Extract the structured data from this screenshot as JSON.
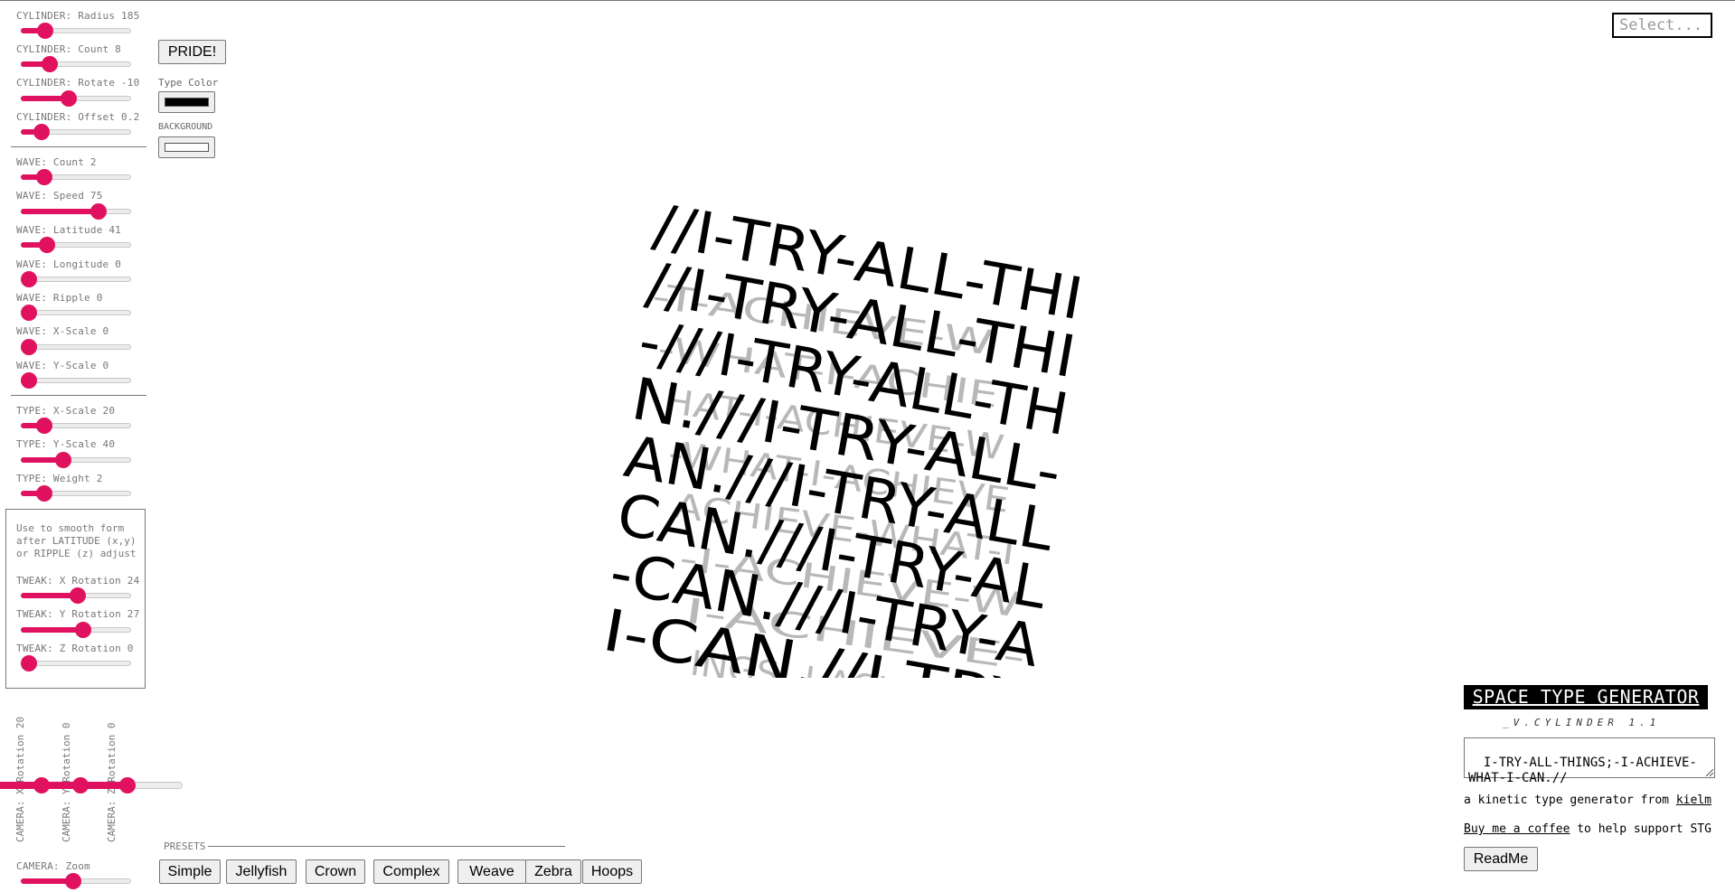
{
  "sliders": {
    "cylinder_radius": {
      "label": "CYLINDER: Radius 185",
      "value": 0.17
    },
    "cylinder_count": {
      "label": "CYLINDER: Count 8",
      "value": 0.22
    },
    "cylinder_rotate": {
      "label": "CYLINDER: Rotate -10",
      "value": 0.42
    },
    "cylinder_offset": {
      "label": "CYLINDER: Offset 0.2",
      "value": 0.13
    },
    "wave_count": {
      "label": "WAVE: Count 2",
      "value": 0.16
    },
    "wave_speed": {
      "label": "WAVE: Speed 75",
      "value": 0.74
    },
    "wave_latitude": {
      "label": "WAVE: Latitude  41",
      "value": 0.19
    },
    "wave_longitude": {
      "label": "WAVE: Longitude 0",
      "value": 0.0
    },
    "wave_ripple": {
      "label": "WAVE: Ripple 0",
      "value": 0.0
    },
    "wave_xscale": {
      "label": "WAVE: X-Scale 0",
      "value": 0.0
    },
    "wave_yscale": {
      "label": "WAVE: Y-Scale 0",
      "value": 0.0
    },
    "type_xscale": {
      "label": "TYPE: X-Scale 20",
      "value": 0.16
    },
    "type_yscale": {
      "label": "TYPE: Y-Scale 40",
      "value": 0.37
    },
    "type_weight": {
      "label": "TYPE: Weight 2",
      "value": 0.16
    },
    "tweak_x": {
      "label": "TWEAK: X Rotation 24",
      "value": 0.52
    },
    "tweak_y": {
      "label": "TWEAK: Y Rotation 27",
      "value": 0.58
    },
    "tweak_z": {
      "label": "TWEAK: Z Rotation 0",
      "value": 0.0
    },
    "camera_zoom": {
      "label": "CAMERA: Zoom",
      "value": 0.47
    }
  },
  "tweak_note": "Use to smooth form\nafter LATITUDE (x,y)\nor RIPPLE (z) adjust",
  "camera": {
    "x_label": "CAMERA: X Rotation 20",
    "y_label": "CAMERA: Y Rotation 0",
    "z_label": "CAMERA: Z Rotation 0",
    "x_value": 0.23,
    "y_value": 0.44,
    "z_value": 0.7
  },
  "pride_button": "PRIDE!",
  "type_color_label": "Type Color",
  "type_color": "#000000",
  "background_label": "BACKGROUND",
  "background_color": "#ffffff",
  "accent_color": "#e0115f",
  "select_placeholder": "Select...",
  "presets_label": "PRESETS",
  "presets": [
    "Simple",
    "Jellyfish",
    "Crown",
    "Complex",
    "Weave",
    "Zebra",
    "Hoops"
  ],
  "app": {
    "title": "SPACE TYPE GENERATOR",
    "version": "_V.CYLINDER 1.1",
    "text_value": "I-TRY-ALL-THINGS;-I-ACHIEVE-WHAT-I-CAN.//",
    "tagline_prefix": "a kinetic type generator from ",
    "tagline_link": "kielm",
    "coffee_link": "Buy me a coffee",
    "coffee_suffix": " to help support STG",
    "readme_button": "ReadMe"
  },
  "canvas": {
    "front_rows": [
      "//I-TRY-ALL-THI",
      "//I-TRY-ALL-THI",
      "-///I-TRY-ALL-TH",
      "N.///I-TRY-ALL-",
      "AN.///I-TRY-ALL",
      "CAN.///I-TRY-AL",
      "-CAN.///I-TRY-A",
      "I-CAN.//I-TRY"
    ],
    "back_rows": [
      "-T-ACHIEVE-W",
      "-WHAT-I-ACHIE",
      "HAT-I-ACHIEVE-W",
      "-WHAT-I-ACHIEVE",
      "ACHIEVE-WHAT-I",
      "-I-ACHIEVE-W",
      "I-ACHIEVE-",
      "INGS;-I-ACHIEVE-W"
    ]
  }
}
